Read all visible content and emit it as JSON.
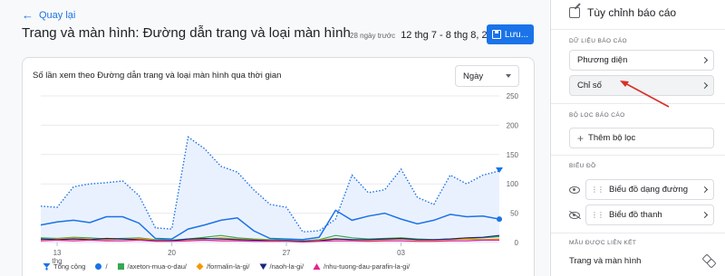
{
  "header": {
    "back_label": "Quay lại",
    "title": "Trang và màn hình: Đường dẫn trang và loại màn hình",
    "date_caption": "28 ngày trước",
    "date_range": "12 thg 7 - 8 thg 8, 2025",
    "save_label": "Lưu..."
  },
  "chart_card": {
    "title": "Số lần xem theo Đường dẫn trang và loại màn hình qua thời gian",
    "granularity": "Ngày"
  },
  "chart_data": {
    "type": "line",
    "x_ticks": [
      "13 thg",
      "20",
      "27",
      "03"
    ],
    "x_tick_index": [
      1,
      8,
      15,
      22
    ],
    "y_ticks": [
      "0",
      "50",
      "100",
      "150",
      "200",
      "250"
    ],
    "ylim": [
      0,
      250
    ],
    "series": [
      {
        "name": "Tổng cộng",
        "color": "#1a73e8",
        "style": "dotted-area",
        "values": [
          62,
          60,
          95,
          100,
          102,
          105,
          80,
          25,
          23,
          180,
          160,
          130,
          120,
          90,
          65,
          60,
          18,
          20,
          40,
          115,
          85,
          90,
          125,
          77,
          65,
          115,
          100,
          115,
          122
        ]
      },
      {
        "name": "/",
        "color": "#1a73e8",
        "style": "line",
        "values": [
          30,
          35,
          38,
          34,
          44,
          44,
          33,
          7,
          6,
          23,
          30,
          38,
          42,
          20,
          7,
          6,
          5,
          9,
          55,
          38,
          45,
          50,
          40,
          32,
          38,
          48,
          44,
          45,
          40
        ]
      },
      {
        "name": "/axeton-mua-o-dau/",
        "color": "#34a853",
        "style": "line",
        "values": [
          8,
          7,
          9,
          8,
          6,
          7,
          8,
          5,
          4,
          6,
          9,
          12,
          8,
          6,
          5,
          4,
          3,
          5,
          12,
          8,
          6,
          7,
          8,
          6,
          5,
          6,
          7,
          8,
          10
        ]
      },
      {
        "name": "/formalin-la-gi/",
        "color": "#f29900",
        "style": "line",
        "values": [
          5,
          6,
          8,
          6,
          5,
          6,
          7,
          4,
          3,
          5,
          6,
          8,
          6,
          5,
          4,
          3,
          2,
          4,
          7,
          5,
          4,
          5,
          6,
          4,
          4,
          5,
          6,
          5,
          6
        ]
      },
      {
        "name": "/naoh-la-gi/",
        "color": "#1a237e",
        "style": "line",
        "values": [
          6,
          5,
          6,
          5,
          7,
          6,
          5,
          3,
          3,
          6,
          7,
          6,
          5,
          4,
          3,
          3,
          2,
          3,
          6,
          5,
          5,
          6,
          7,
          5,
          5,
          6,
          8,
          9,
          12
        ]
      },
      {
        "name": "/nhu-tuong-dau-parafin-la-gi/",
        "color": "#e52592",
        "style": "line",
        "values": [
          3,
          4,
          3,
          4,
          3,
          3,
          4,
          2,
          2,
          3,
          4,
          3,
          3,
          2,
          2,
          2,
          1,
          2,
          3,
          3,
          2,
          3,
          3,
          2,
          2,
          3,
          3,
          4,
          4
        ]
      }
    ]
  },
  "legend": [
    {
      "label": "Tổng cộng",
      "color": "#1a73e8",
      "shape": "pin"
    },
    {
      "label": "/",
      "color": "#1a73e8",
      "shape": "circle"
    },
    {
      "label": "/axeton-mua-o-dau/",
      "color": "#34a853",
      "shape": "square"
    },
    {
      "label": "/formalin-la-gi/",
      "color": "#f29900",
      "shape": "diamond"
    },
    {
      "label": "/naoh-la-gi/",
      "color": "#1a237e",
      "shape": "triangle-down"
    },
    {
      "label": "/nhu-tuong-dau-parafin-la-gi/",
      "color": "#e52592",
      "shape": "triangle-up"
    }
  ],
  "panel": {
    "title": "Tùy chỉnh báo cáo",
    "data_section": "DỮ LIỆU BÁO CÁO",
    "dimensions": "Phương diện",
    "metrics": "Chỉ số",
    "filter_section": "BỘ LỌC BÁO CÁO",
    "add_filter": "Thêm bộ lọc",
    "charts_section": "BIỂU ĐỒ",
    "line_chart": "Biểu đồ dạng đường",
    "bar_chart": "Biểu đồ thanh",
    "linked_section": "MẪU ĐƯỢC LIÊN KẾT",
    "linked_item": "Trang và màn hình"
  },
  "colors": {
    "accent": "#1a73e8",
    "annotation": "#d93025"
  }
}
